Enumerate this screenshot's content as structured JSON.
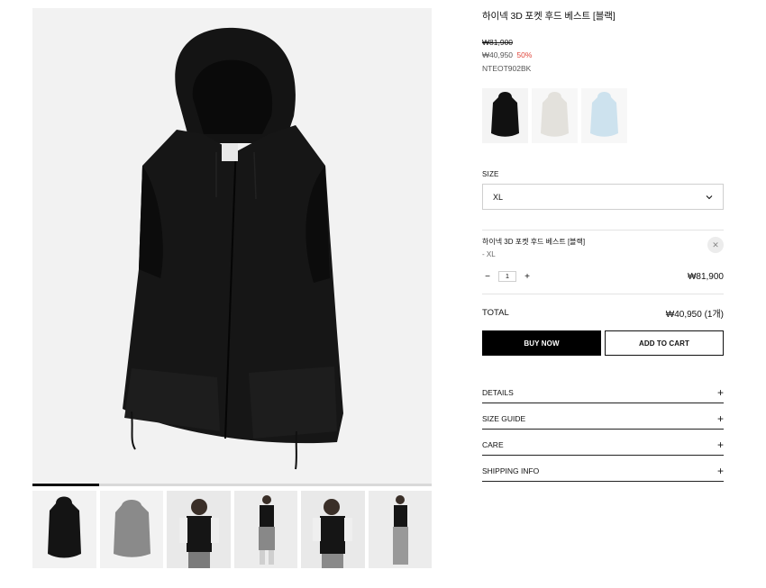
{
  "product": {
    "title": "하이넥 3D 포켓 후드 베스트 [블랙]",
    "price_original": "₩81,900",
    "price_sale": "₩40,950",
    "discount": "50%",
    "sku": "NTEOT902BK"
  },
  "gallery": {
    "main_image": "black-hooded-vest",
    "progress_fraction": 0.167,
    "thumbnails": [
      {
        "image": "black-vest-front"
      },
      {
        "image": "gray-vest-back"
      },
      {
        "image": "model-black-vest-closeup"
      },
      {
        "image": "model-black-vest-full"
      },
      {
        "image": "model-black-vest-pose"
      },
      {
        "image": "model-black-vest-side"
      }
    ]
  },
  "swatches": [
    {
      "color": "#111111"
    },
    {
      "color": "#e8e6e2"
    },
    {
      "color": "#cfe3ef"
    }
  ],
  "size": {
    "label": "SIZE",
    "selected": "XL"
  },
  "line_item": {
    "name": "하이넥 3D 포켓 후드 베스트 [블랙]",
    "option": "- XL",
    "quantity": "1",
    "price": "₩81,900",
    "minus": "−",
    "plus": "+",
    "remove": "✕"
  },
  "total": {
    "label": "TOTAL",
    "value": "₩40,950 (1개)"
  },
  "actions": {
    "buy_now": "BUY NOW",
    "add_to_cart": "ADD TO CART"
  },
  "accordion": [
    {
      "label": "DETAILS",
      "icon": "+"
    },
    {
      "label": "SIZE GUIDE",
      "icon": "+"
    },
    {
      "label": "CARE",
      "icon": "+"
    },
    {
      "label": "SHIPPING INFO",
      "icon": "+"
    }
  ],
  "colors": {
    "accent": "#000000",
    "discount": "#e0453a"
  }
}
